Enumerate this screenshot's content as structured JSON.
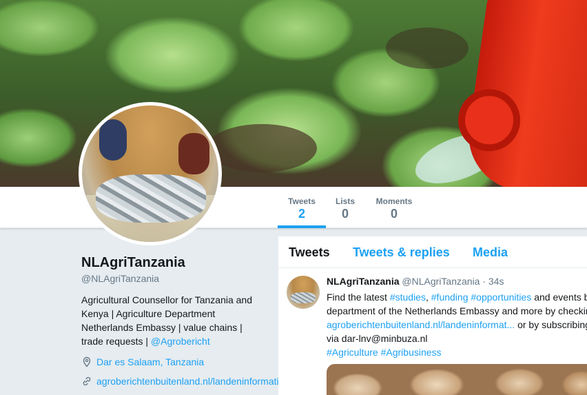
{
  "nav": {
    "items": [
      {
        "label": "Tweets",
        "value": "2"
      },
      {
        "label": "Lists",
        "value": "0"
      },
      {
        "label": "Moments",
        "value": "0"
      }
    ]
  },
  "profile": {
    "name": "NLAgriTanzania",
    "handle": "@NLAgriTanzania",
    "bio_text": "Agricultural Counsellor for Tanzania and Kenya | Agriculture Department Netherlands Embassy | value chains | trade requests |",
    "bio_link": "@Agrobericht",
    "location": "Dar es Salaam, Tanzania",
    "website": "agroberichtenbuitenland.nl/landeninformatie"
  },
  "timeline": {
    "tabs": [
      "Tweets",
      "Tweets & replies",
      "Media"
    ]
  },
  "tweet": {
    "name": "NLAgriTanzania",
    "handle": "@NLAgriTanzania",
    "dot": "·",
    "time": "34s",
    "line1_text": "Find the latest",
    "tag_studies": "#studies",
    "comma": ",",
    "tag_funding": "#funding",
    "tag_opportunities": "#opportunities",
    "line1_end": "and events by the",
    "line2": "department of the Netherlands Embassy and more by checking",
    "link": "agroberichtenbuitenland.nl/landeninformat...",
    "line3_end": "or by subscribing",
    "line4": "via dar-lnv@minbuza.nl",
    "tag_agriculture": "#Agriculture",
    "tag_agribusiness": "#Agribusiness"
  },
  "icons": {
    "location": "location-pin-icon",
    "link": "link-icon"
  },
  "colors": {
    "accent": "#1da1f2",
    "secondary_text": "#657786",
    "background": "#e6ecf0"
  }
}
